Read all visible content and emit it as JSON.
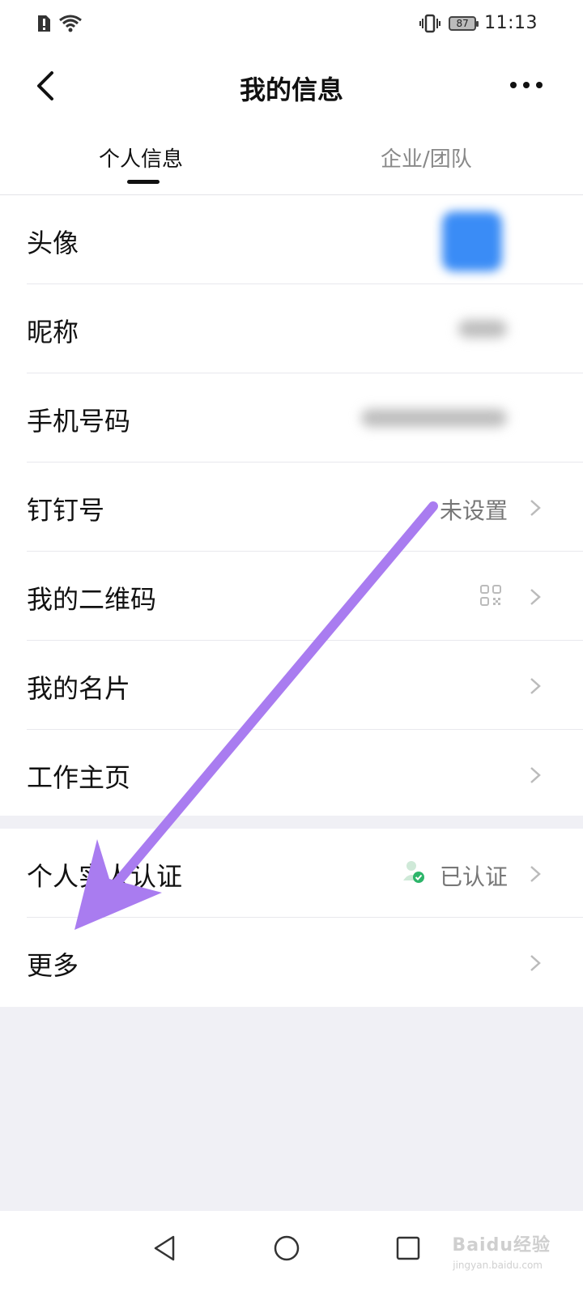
{
  "status_bar": {
    "time": "11:13",
    "battery": "87"
  },
  "header": {
    "title": "我的信息"
  },
  "tabs": [
    {
      "label": "个人信息",
      "active": true
    },
    {
      "label": "企业/团队",
      "active": false
    }
  ],
  "section1": {
    "rows": [
      {
        "label": "头像"
      },
      {
        "label": "昵称"
      },
      {
        "label": "手机号码"
      },
      {
        "label": "钉钉号",
        "value": "未设置"
      },
      {
        "label": "我的二维码"
      },
      {
        "label": "我的名片"
      },
      {
        "label": "工作主页"
      }
    ]
  },
  "section2": {
    "rows": [
      {
        "label": "个人实人认证",
        "value": "已认证"
      },
      {
        "label": "更多"
      }
    ]
  },
  "watermark": {
    "text": "Baidu经验",
    "sub": "jingyan.baidu.com"
  },
  "colors": {
    "arrow": "#a97cf0",
    "avatar": "#3a8cf6",
    "verified": "#2db56a"
  }
}
